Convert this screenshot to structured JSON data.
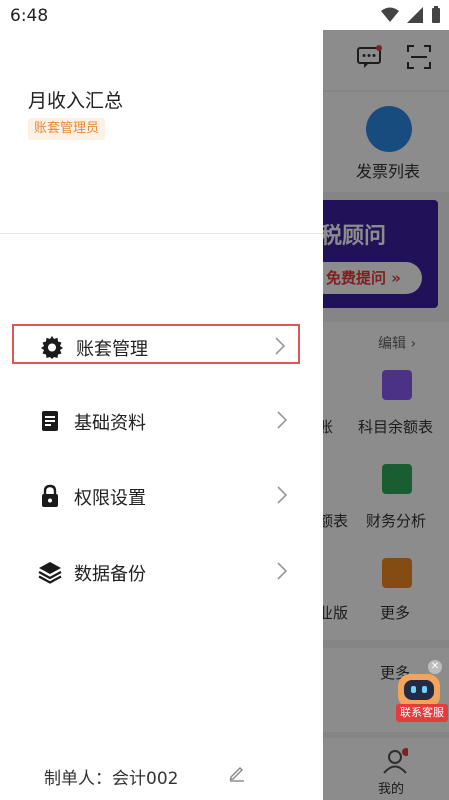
{
  "status_bar": {
    "time": "6:48"
  },
  "drawer": {
    "account_name": "月收入汇总",
    "role": "账套管理员",
    "menu": [
      {
        "label": "账套管理",
        "icon": "gear-icon"
      },
      {
        "label": "基础资料",
        "icon": "document-icon"
      },
      {
        "label": "权限设置",
        "icon": "lock-icon"
      },
      {
        "label": "数据备份",
        "icon": "layers-icon"
      }
    ],
    "footer": {
      "maker_label": "制单人：会计002"
    }
  },
  "background": {
    "invoice_list": "发票列表",
    "banner_title": "税顾问",
    "banner_button": "免费提问 »",
    "edit_label": "编辑 ›",
    "grid": [
      "账",
      "科目余额表",
      "额表",
      "财务分析",
      "业版",
      "更多"
    ],
    "more_label": "更多",
    "tab_me": "我的",
    "support_label": "联系客服"
  },
  "colors": {
    "accent": "#e88a35",
    "highlight_border": "#e05656",
    "blue": "#2c8ae6"
  }
}
